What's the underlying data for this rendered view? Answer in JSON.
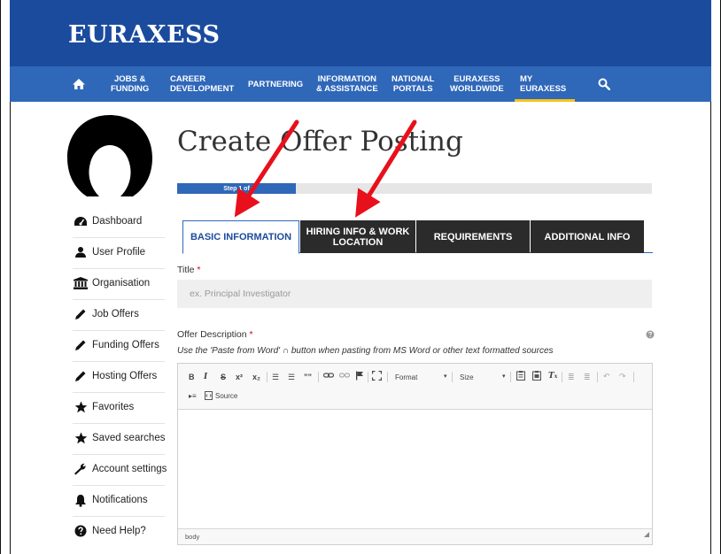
{
  "brand": "EURAXESS",
  "nav": {
    "items": [
      {
        "label": "JOBS &\nFUNDING"
      },
      {
        "label": "CAREER\nDEVELOPMENT"
      },
      {
        "label": "PARTNERING"
      },
      {
        "label": "INFORMATION\n& ASSISTANCE"
      },
      {
        "label": "NATIONAL\nPORTALS"
      },
      {
        "label": "EURAXESS\nWORLDWIDE"
      },
      {
        "label": "MY\nEURAXESS"
      }
    ],
    "active": "MY EURAXESS"
  },
  "sidebar": {
    "items": [
      {
        "label": "Dashboard",
        "icon": "dashboard-icon"
      },
      {
        "label": "User Profile",
        "icon": "user-icon"
      },
      {
        "label": "Organisation",
        "icon": "institution-icon"
      },
      {
        "label": "Job Offers",
        "icon": "pencil-icon"
      },
      {
        "label": "Funding Offers",
        "icon": "pencil-icon"
      },
      {
        "label": "Hosting Offers",
        "icon": "pencil-icon"
      },
      {
        "label": "Favorites",
        "icon": "star-icon"
      },
      {
        "label": "Saved searches",
        "icon": "star-icon"
      },
      {
        "label": "Account settings",
        "icon": "wrench-icon"
      },
      {
        "label": "Notifications",
        "icon": "bell-icon"
      },
      {
        "label": "Need Help?",
        "icon": "question-icon"
      }
    ]
  },
  "main": {
    "title": "Create Offer Posting",
    "progress": {
      "label": "Step 1 of",
      "fraction": 0.25
    },
    "tabs": [
      {
        "label": "BASIC INFORMATION",
        "active": true
      },
      {
        "label": "HIRING INFO & WORK\nLOCATION",
        "active": false
      },
      {
        "label": "REQUIREMENTS",
        "active": false
      },
      {
        "label": "ADDITIONAL INFO",
        "active": false
      }
    ],
    "title_field": {
      "label": "Title",
      "required_mark": "*",
      "placeholder": "ex. Principal Investigator",
      "value": ""
    },
    "description_field": {
      "label": "Offer Description",
      "required_mark": "*",
      "help": "Use the 'Paste from Word' ∩ button when pasting from MS Word or other text formatted sources"
    },
    "editor": {
      "toolbar_row1": [
        "B",
        "I",
        "S",
        "x²",
        "x₂",
        "☰",
        "☰",
        "””"
      ],
      "format_label": "Format",
      "size_label": "Size",
      "source_label": "Source",
      "status_path": "body"
    }
  },
  "colors": {
    "header_bg": "#1b4b9d",
    "nav_bg": "#2f67b9",
    "active_underline": "#f7c21c",
    "annotation_arrow": "#e8101a"
  }
}
